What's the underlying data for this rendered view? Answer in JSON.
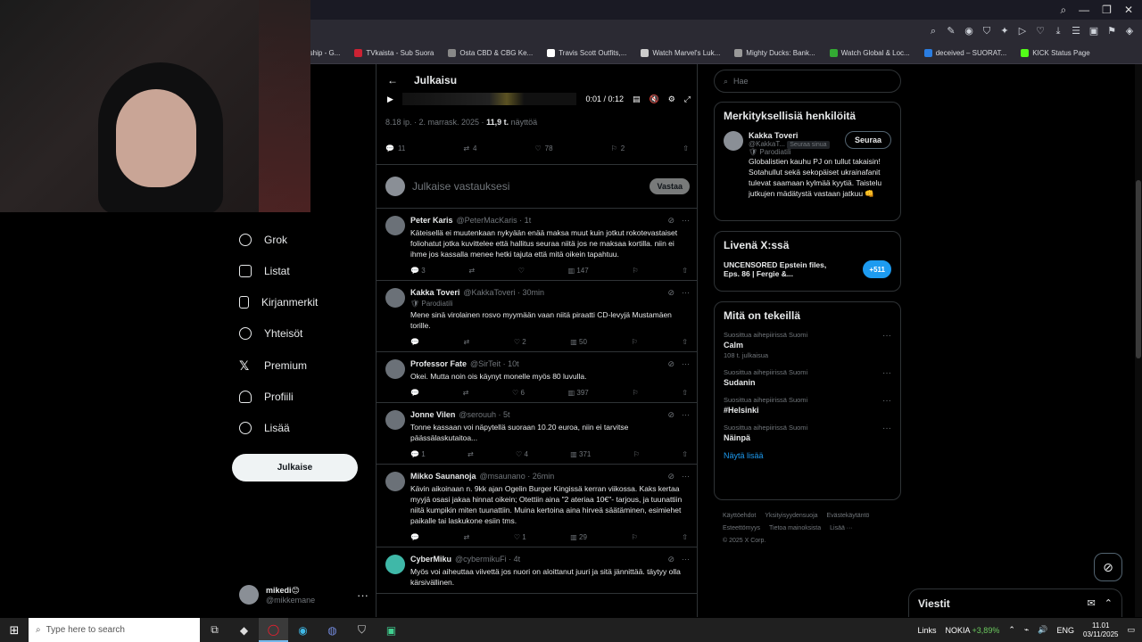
{
  "browser": {
    "bookmarks": [
      "rship - G...",
      "TVkaista - Sub Suora",
      "Osta CBD & CBG Ke...",
      "Travis Scott Outfits,...",
      "Watch Marvel's Luk...",
      "Mighty Ducks: Bank...",
      "Watch Global & Loc...",
      "deceived – SUORAT...",
      "KICK Status Page"
    ]
  },
  "nav": {
    "items": [
      {
        "label": "Grok",
        "icon": "grok-icon"
      },
      {
        "label": "Listat",
        "icon": "list-icon"
      },
      {
        "label": "Kirjanmerkit",
        "icon": "bookmark-icon"
      },
      {
        "label": "Yhteisöt",
        "icon": "communities-icon"
      },
      {
        "label": "Premium",
        "icon": "x-logo-icon"
      },
      {
        "label": "Profiili",
        "icon": "profile-icon"
      },
      {
        "label": "Lisää",
        "icon": "more-icon"
      }
    ],
    "post_label": "Julkaise",
    "account": {
      "display_name": "mikedi😊",
      "handle": "@mikkemane"
    }
  },
  "post": {
    "header_title": "Julkaisu",
    "video_time": "0:01 / 0:12",
    "meta_time": "8.18 ip. · 2. marrask. 2025 · ",
    "meta_views": "11,9 t.",
    "meta_views_label": " näyttöä",
    "stats": {
      "replies": "11",
      "reposts": "4",
      "likes": "78",
      "bookmarks": "2"
    },
    "reply_placeholder": "Julkaise vastauksesi",
    "reply_button": "Vastaa"
  },
  "replies": [
    {
      "name": "Peter Karis",
      "handle": "@PeterMacKaris · 1t",
      "badge": "",
      "text": "Käteisellä ei muutenkaan nykyään enää maksa muut kuin jotkut rokotevastaiset foliohatut jotka kuvittelee että hallitus seuraa niitä jos ne maksaa kortilla. niin ei ihme jos kassalla menee hetki tajuta että mitä oikein tapahtuu.",
      "replies": "3",
      "reposts": "",
      "likes": "",
      "views": "147"
    },
    {
      "name": "Kakka Toveri",
      "handle": "@KakkaToveri · 30min",
      "badge": "🛡 Parodiatili",
      "text": "Mene sinä virolainen rosvo myymään vaan niitä piraatti CD-levyjä Mustamäen torille.",
      "replies": "",
      "reposts": "",
      "likes": "2",
      "views": "50"
    },
    {
      "name": "Professor Fate",
      "handle": "@SirTeit · 10t",
      "badge": "",
      "text": "Okei. Mutta noin ois käynyt monelle myös 80 luvulla.",
      "replies": "",
      "reposts": "",
      "likes": "6",
      "views": "397"
    },
    {
      "name": "Jonne Vilen",
      "handle": "@serouuh · 5t",
      "badge": "",
      "text": "Tonne kassaan voi näpytellä suoraan 10.20 euroa, niin ei tarvitse päässälaskutaitoa...",
      "replies": "1",
      "reposts": "",
      "likes": "4",
      "views": "371"
    },
    {
      "name": "Mikko Saunanoja",
      "handle": "@msaunano · 26min",
      "badge": "",
      "text": "Kävin aikoinaan n. 9kk ajan Ogelin Burger Kingissä kerran viikossa. Kaks kertaa myyjä osasi jakaa hinnat oikein; Otettiin aina \"2 ateriaa 10€\"- tarjous, ja tuunattiin niitä kumpikin miten tuunattiin. Muina kertoina aina hirveä säätäminen, esimiehet paikalle tai laskukone esiin tms.",
      "replies": "",
      "reposts": "",
      "likes": "1",
      "views": "29"
    },
    {
      "name": "CyberMiku",
      "handle": "@cybermikuFi · 4t",
      "badge": "",
      "text": "Myös voi aiheuttaa viivettä jos nuori on aloittanut juuri ja sitä jännittää. täytyy olla kärsivällinen.",
      "replies": "",
      "reposts": "",
      "likes": "",
      "views": ""
    }
  ],
  "right": {
    "search_placeholder": "Hae",
    "relevant_title": "Merkityksellisiä henkilöitä",
    "person": {
      "name": "Kakka Toveri",
      "handle": "@KakkaT...",
      "follows_you": "Seuraa sinua",
      "badge": "🛡 Parodiatili",
      "follow_label": "Seuraa",
      "bio": "Globalistien kauhu PJ on tullut takaisin! Sotahullut sekä sekopäiset ukrainafanit tulevat saamaan kylmää kyytiä. Taistelu jutkujen mädätystä vastaan jatkuu 👊"
    },
    "live_title": "Livenä X:ssä",
    "live_text": "UNCENSORED Epstein files, Eps. 86 | Fergie &...",
    "live_count": "+511",
    "trending_title": "Mitä on tekeillä",
    "trends": [
      {
        "context": "Suosittua aihepiirissä Suomi",
        "title": "Calm",
        "count": "108 t. julkaisua"
      },
      {
        "context": "Suosittua aihepiirissä Suomi",
        "title": "Sudanin",
        "count": ""
      },
      {
        "context": "Suosittua aihepiirissä Suomi",
        "title": "#Helsinki",
        "count": ""
      },
      {
        "context": "Suosittua aihepiirissä Suomi",
        "title": "Näinpä",
        "count": ""
      }
    ],
    "show_more": "Näytä lisää",
    "footer": [
      "Käyttöehdot",
      "Yksityisyydensuoja",
      "Evästekäytäntö",
      "Esteettömyys",
      "Tietoa mainoksista",
      "Lisää ···",
      "© 2025 X Corp."
    ],
    "messages_label": "Viestit"
  },
  "taskbar": {
    "search_placeholder": "Type here to search",
    "links": "Links",
    "stock_name": "NOKIA",
    "stock_change": "+3,89%",
    "lang": "ENG",
    "time": "11.01",
    "date": "03/11/2025"
  }
}
